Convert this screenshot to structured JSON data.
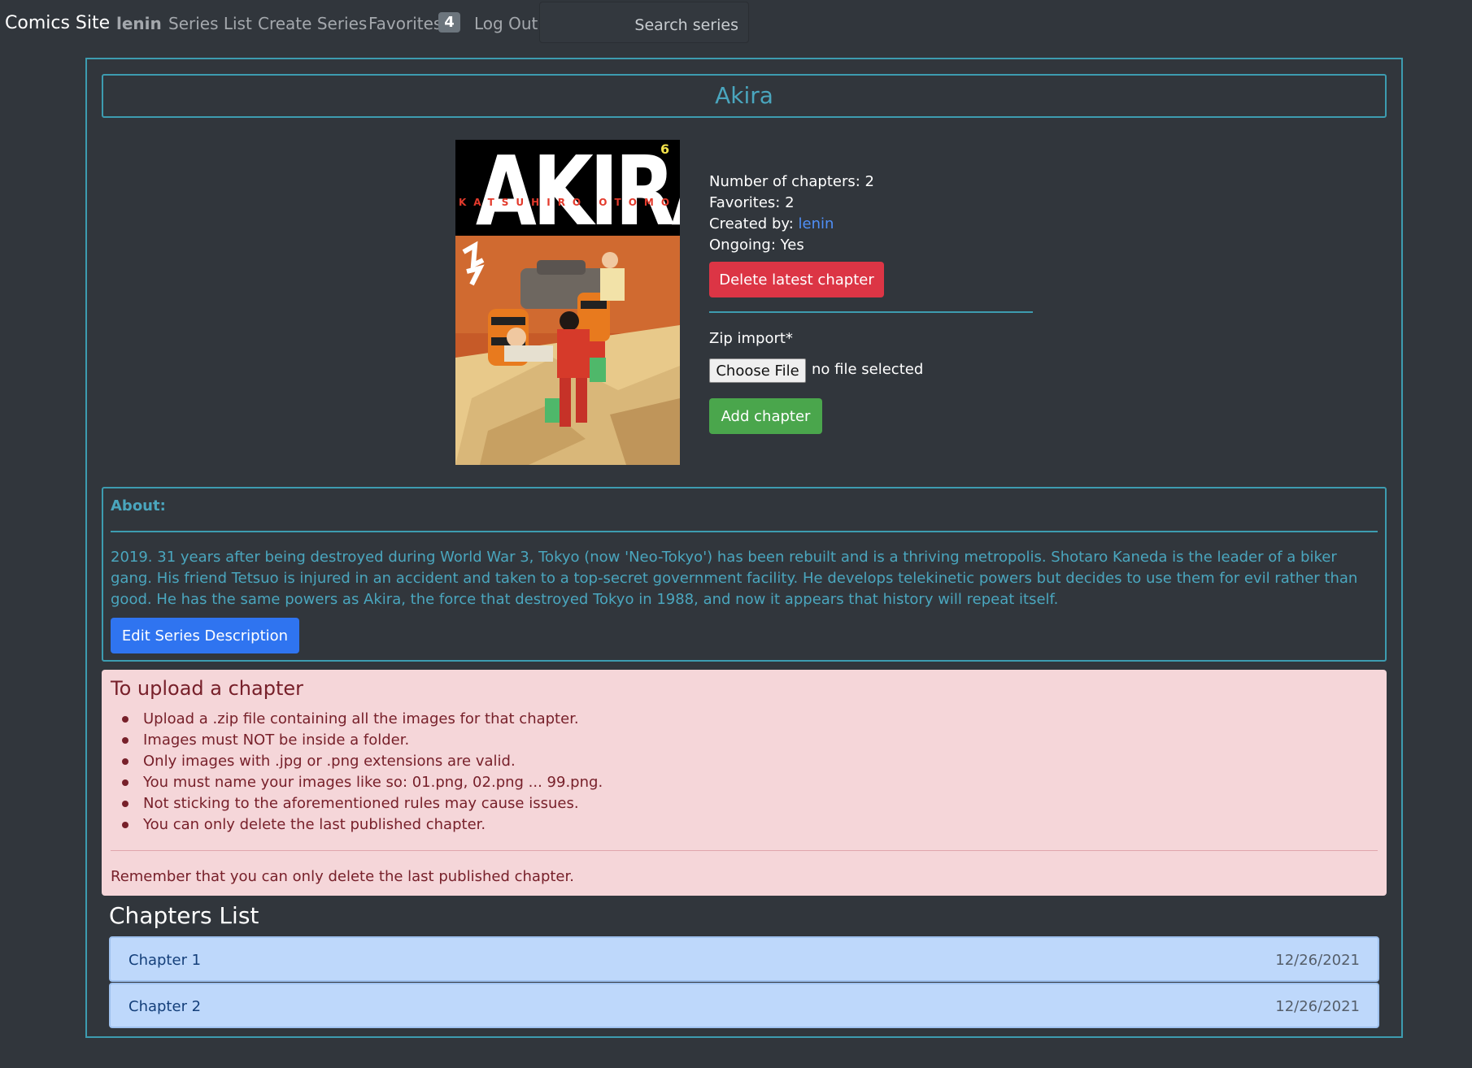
{
  "navbar": {
    "brand": "Comics Site",
    "user": "lenin",
    "series_list": "Series List",
    "create_series": "Create Series",
    "favorites": "Favorites",
    "favorites_count": "4",
    "logout": "Log Out",
    "search_placeholder": "Search series"
  },
  "series": {
    "title": "Akira",
    "cover": {
      "title_text": "AKIRA",
      "author_text": "KATSUHIRO OTOMO",
      "volume": "6"
    },
    "chapters_label": "Number of chapters: 2",
    "favorites_label": "Favorites: 2",
    "created_by_label": "Created by: ",
    "created_by_user": "lenin",
    "ongoing_label": "Ongoing: Yes",
    "delete_button": "Delete latest chapter",
    "zip_label": "Zip import*",
    "choose_file": "Choose File",
    "file_status": "no file selected",
    "add_button": "Add chapter"
  },
  "about": {
    "heading": "About:",
    "text": "2019. 31 years after being destroyed during World War 3, Tokyo (now 'Neo-Tokyo') has been rebuilt and is a thriving metropolis. Shotaro Kaneda is the leader of a biker gang. His friend Tetsuo is injured in an accident and taken to a top-secret government facility. He develops telekinetic powers but decides to use them for evil rather than good. He has the same powers as Akira, the force that destroyed Tokyo in 1988, and now it appears that history will repeat itself.",
    "edit_button": "Edit Series Description"
  },
  "upload_info": {
    "title": "To upload a chapter",
    "rules": [
      "Upload a .zip file containing all the images for that chapter.",
      "Images must NOT be inside a folder.",
      "Only images with .jpg or .png extensions are valid.",
      "You must name your images like so: 01.png, 02.png ... 99.png.",
      "Not sticking to the aforementioned rules may cause issues.",
      "You can only delete the last published chapter."
    ],
    "footer": "Remember that you can only delete the last published chapter."
  },
  "chapters": {
    "title": "Chapters List",
    "items": [
      {
        "name": "Chapter 1",
        "date": "12/26/2021"
      },
      {
        "name": "Chapter 2",
        "date": "12/26/2021"
      }
    ]
  },
  "colors": {
    "background": "#31363c",
    "accent": "#3d9cb0",
    "danger": "#dc3545",
    "success": "#4aa64c",
    "primary": "#2f74f0",
    "alert_bg": "#f5d6d9",
    "chapter_bg": "#bed8fb"
  }
}
